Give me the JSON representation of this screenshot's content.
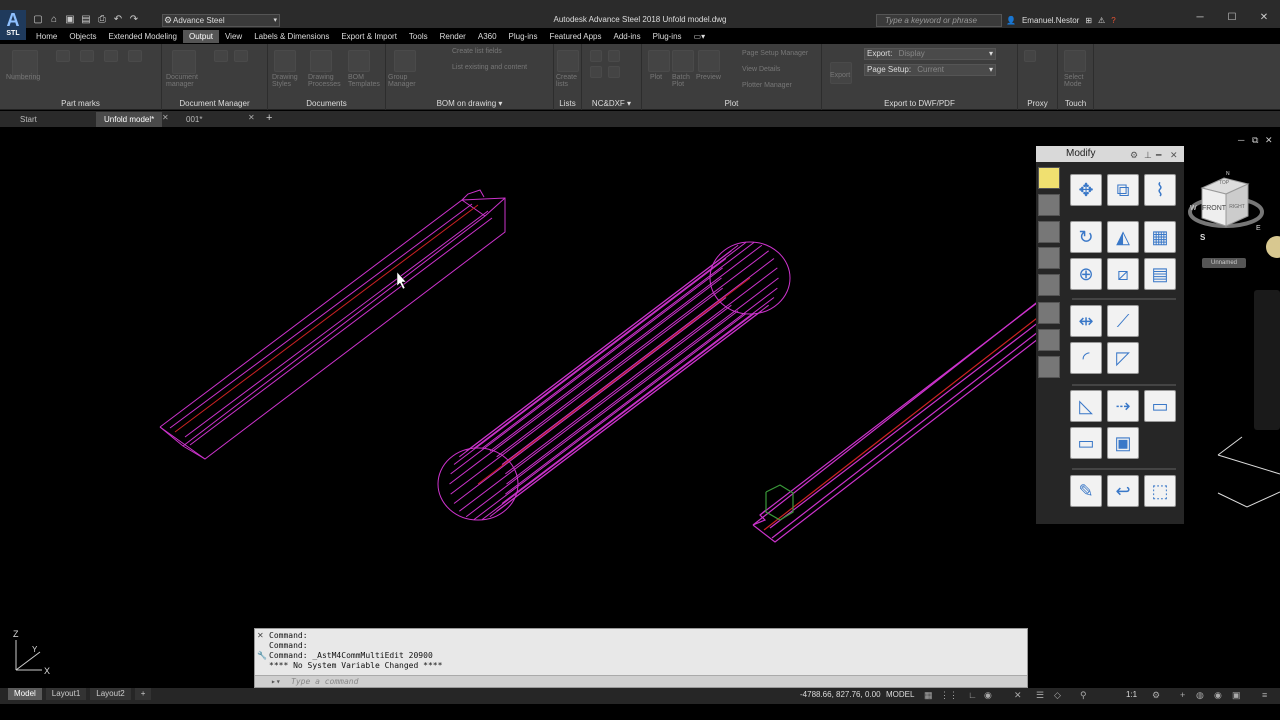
{
  "app": {
    "logo_letter": "A",
    "logo_sub": "STL",
    "title": "Autodesk Advance Steel 2018   Unfold model.dwg",
    "workspace": "Advance Steel",
    "search_placeholder": "Type a keyword or phrase",
    "user": "Emanuel.Nestor"
  },
  "ribbon": {
    "tabs": [
      "Home",
      "Objects",
      "Extended Modeling",
      "Output",
      "View",
      "Labels & Dimensions",
      "Export & Import",
      "Tools",
      "Render",
      "A360",
      "Plug-ins",
      "Featured Apps",
      "Add-ins",
      "Plug-ins"
    ],
    "active_tab": "Output",
    "panels": [
      "Part marks",
      "Document Manager",
      "Documents",
      "BOM on drawing",
      "Lists",
      "NC&DXF",
      "Plot",
      "Export to DWF/PDF",
      "Proxy",
      "Touch"
    ],
    "dim_texts": [
      "Numbering",
      "Document manager",
      "Drawing Styles",
      "Drawing Processes",
      "BOM Templates",
      "Group Manager",
      "Create list fields",
      "List existing and content",
      "Create lists",
      "Plot",
      "Batch Plot",
      "Preview",
      "Page Setup Manager",
      "View Details",
      "Plotter Manager",
      "Export",
      "Select Mode"
    ],
    "export_label": "Export:",
    "export_value": "Display",
    "pagesetup_label": "Page Setup:",
    "pagesetup_value": "Current"
  },
  "doc_tabs": [
    "Start",
    "Unfold model*",
    "001*"
  ],
  "active_doc": "Unfold model*",
  "modify_palette": {
    "title": "Modify",
    "tools": [
      "move",
      "copy-scale",
      "stretch",
      "rotate",
      "mirror",
      "array",
      "sphere-tool",
      "split-tool",
      "array-3d",
      "align",
      "break-line",
      "fillet",
      "chamfer",
      "extend",
      "offset",
      "trim",
      "trim-box",
      "join",
      "pen-edit",
      "bend",
      "cube"
    ]
  },
  "viewcube": {
    "face": "FRONT",
    "side": "RIGHT",
    "top": "TOP",
    "compass": [
      "N",
      "E",
      "S",
      "W"
    ],
    "ucs": "Unnamed"
  },
  "command_line": {
    "history": [
      "Command:",
      "Command:",
      "Command: _AstM4CommMultiEdit 20900",
      "**** No System Variable Changed ****"
    ],
    "placeholder": "Type a command"
  },
  "layout_tabs": [
    "Model",
    "Layout1",
    "Layout2"
  ],
  "active_layout": "Model",
  "status": {
    "coords": "-4788.66, 827.76, 0.00",
    "space": "MODEL",
    "scale": "1:1"
  },
  "ucs_axes": [
    "Z",
    "Y",
    "X"
  ],
  "colors": {
    "wire": "#cc33cc",
    "axis": "#cc2222",
    "background": "#000000",
    "ribbon": "#3d3d3d"
  }
}
